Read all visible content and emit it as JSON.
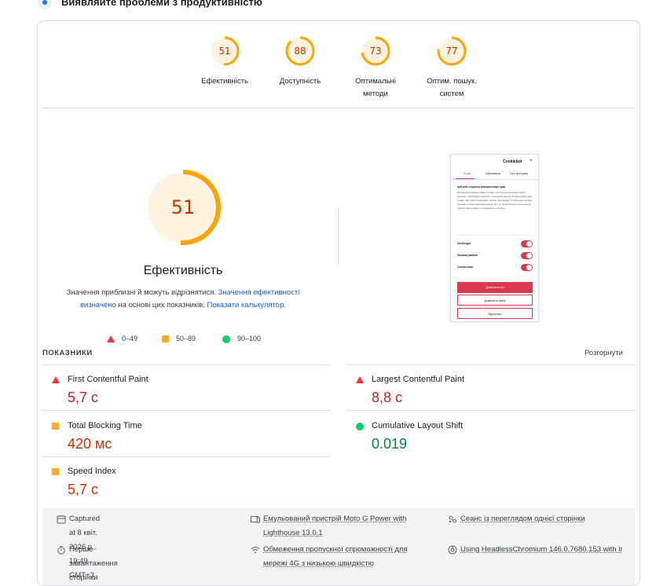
{
  "header": {
    "title": "Виявляйте проблеми з продуктивністю"
  },
  "gauges": [
    {
      "score": "51",
      "label_lines": [
        "Ефективність"
      ],
      "fraction": 0.51
    },
    {
      "score": "88",
      "label_lines": [
        "Доступність"
      ],
      "fraction": 0.88
    },
    {
      "score": "73",
      "label_lines": [
        "Оптимальні",
        "методи"
      ],
      "fraction": 0.73
    },
    {
      "score": "77",
      "label_lines": [
        "Оптим. пошук.",
        "систем"
      ],
      "fraction": 0.77
    }
  ],
  "performance": {
    "score": "51",
    "fraction": 0.51,
    "title": "Ефективність",
    "desc_prefix": "Значення приблизні й можуть відрізнятися. ",
    "desc_link1": "Значення ефективності визначено",
    "desc_middle": " на основі цих показників. ",
    "desc_link2": "Показати калькулятор",
    "desc_suffix": "."
  },
  "legend": {
    "poor": "0–49",
    "average": "50–89",
    "good": "90–100"
  },
  "screenshot": {
    "logo": "Cookiebot",
    "close": "×",
    "tabs": [
      "Згода",
      "Інформація",
      "Про програму"
    ],
    "heading": "Цей веб-сторінка використовує куки",
    "paragraph": "Ми використовуємо файли cookie, щоб персоналізувати вміст і рекламу, пропонувати функції соціальних мереж та аналізувати наш трафік. Ми також передаємо нашим партнерам із соціальних мереж, реклами й аналітики інформацію про те, як ви користуєтеся нашим сайтом. Вони можуть поєднувати її з іншою",
    "toggles": [
      "Необхідні",
      "Налаштування",
      "Статистика"
    ],
    "buttons": [
      "Дозволити всі",
      "Дозволити вибір",
      "Відхилити"
    ],
    "colors": {
      "accent": "#d9384e"
    }
  },
  "metrics": {
    "heading": "ПОКАЗНИКИ",
    "expand_label": "Розгорнути",
    "items": [
      {
        "name": "First Contentful Paint",
        "value": "5,7 с",
        "status": "poor"
      },
      {
        "name": "Largest Contentful Paint",
        "value": "8,8 с",
        "status": "poor"
      },
      {
        "name": "Total Blocking Time",
        "value": "420 мс",
        "status": "average"
      },
      {
        "name": "Cumulative Layout Shift",
        "value": "0.019",
        "status": "good"
      },
      {
        "name": "Speed Index",
        "value": "5,7 с",
        "status": "average"
      }
    ]
  },
  "footer": {
    "captured": "Captured at 8 квіт. 2026 р., 19:49 GMT+3",
    "first_load": "Перше завантаження сторінки",
    "device_line1": "Емульований пристрій Moto G Power with",
    "device_line2": "Lighthouse 13.0.1",
    "throttle_line1": "Обмеження пропускної спроможності для",
    "throttle_line2": "мережі 4G з низькою швидкістю",
    "session": "Сеанс із переглядом однієї сторінки",
    "browser": "Using HeadlessChromium 146.0.7680.153 with lr"
  },
  "colors": {
    "poor": "#ff3333",
    "average": "#ffaa33",
    "good": "#0cce6b",
    "average_text": "#c33300",
    "link": "#1a5fd0"
  }
}
